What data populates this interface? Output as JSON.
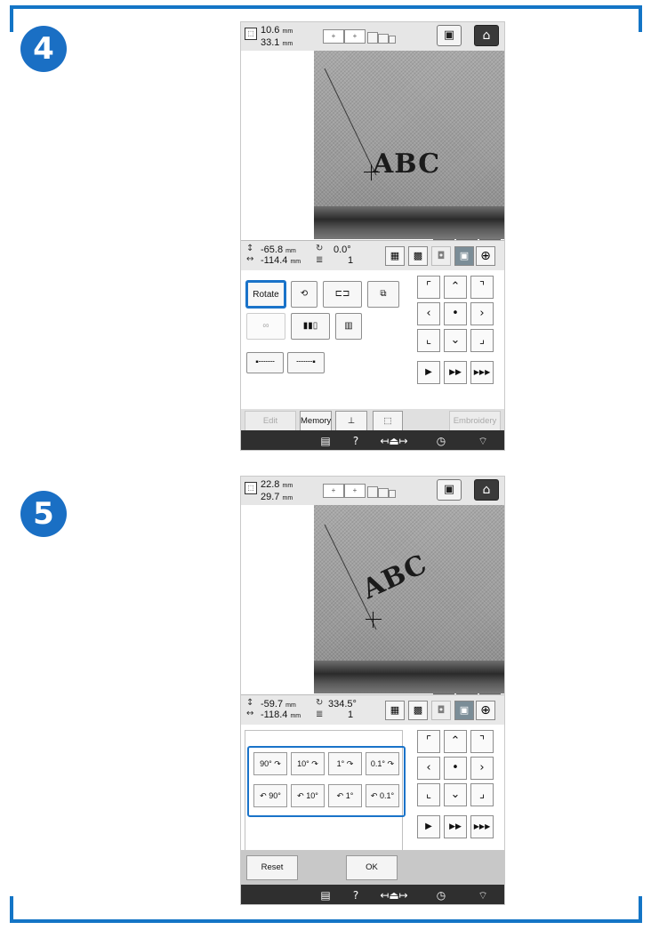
{
  "steps": [
    {
      "number": "4",
      "size": {
        "height": "10.6",
        "width": "33.1",
        "unit": "mm"
      },
      "position": {
        "y": "-65.8",
        "x": "-114.4",
        "unit": "mm",
        "angle": "0.0°",
        "color_count": "1"
      },
      "edit_panel": {
        "rotate_label": "Rotate"
      },
      "bottom": {
        "edit_label": "Edit",
        "memory_label": "Memory",
        "embroidery_label": "Embroidery"
      },
      "design_text": "ABC"
    },
    {
      "number": "5",
      "size": {
        "height": "22.8",
        "width": "29.7",
        "unit": "mm"
      },
      "position": {
        "y": "-59.7",
        "x": "-118.4",
        "unit": "mm",
        "angle": "334.5°",
        "color_count": "1"
      },
      "rotate_panel": {
        "buttons": [
          "90°",
          "10°",
          "1°",
          "0.1°",
          "90°",
          "10°",
          "1°",
          "0.1°"
        ],
        "reset_label": "Reset",
        "ok_label": "OK"
      },
      "design_text": "ABC"
    }
  ],
  "frame_selector": {
    "symbol": "+"
  },
  "icons": {
    "needle_count": "3"
  },
  "colors": {
    "accent": "#1a73c9",
    "badge": "#1a6fc4",
    "frame": "#1475c6"
  }
}
